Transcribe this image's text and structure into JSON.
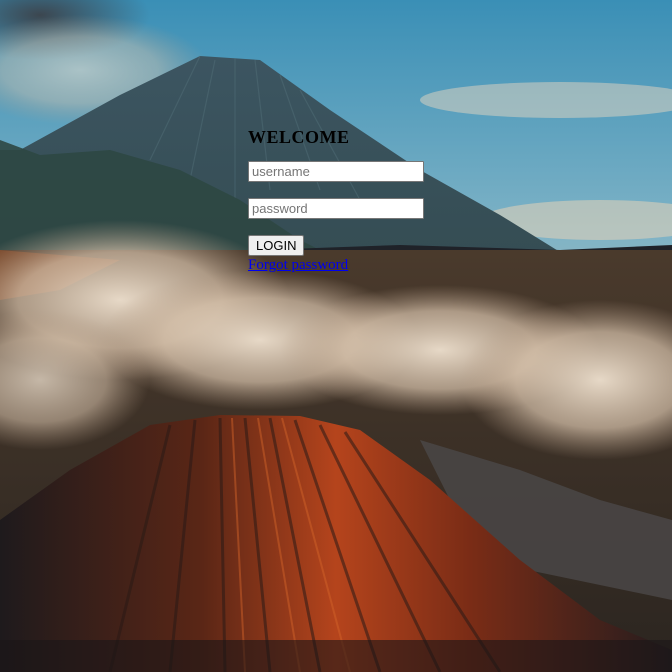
{
  "login": {
    "title": "WELCOME",
    "username_placeholder": "username",
    "username_value": "",
    "password_placeholder": "password",
    "password_value": "",
    "login_label": "LOGIN",
    "forgot_label": "Forgot password"
  },
  "colors": {
    "link": "#0000ee",
    "button_bg": "#efefef",
    "input_bg": "#ffffff",
    "sky_top": "#3f8fb5",
    "sky_horizon": "#e9c89a",
    "volcano_glow": "#b5441c"
  }
}
